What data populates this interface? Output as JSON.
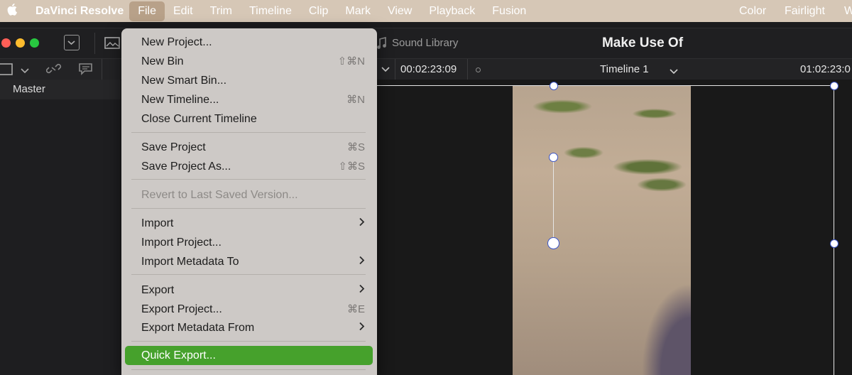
{
  "menubar": {
    "app_name": "DaVinci Resolve",
    "menus": [
      "File",
      "Edit",
      "Trim",
      "Timeline",
      "Clip",
      "Mark",
      "View",
      "Playback",
      "Fusion"
    ],
    "right_menus": [
      "Color",
      "Fairlight",
      "W"
    ],
    "active_menu": "File"
  },
  "window": {
    "project_title": "Make Use Of",
    "sound_library_label": "Sound Library",
    "traffic_lights": {
      "close": "#ff5f57",
      "minimize": "#febc2e",
      "zoom": "#28c840"
    }
  },
  "toolbar": {
    "timecode_left": "00:02:23:09",
    "timeline_name": "Timeline 1",
    "timecode_right": "01:02:23:0"
  },
  "media_pool": {
    "master_label": "Master"
  },
  "file_menu": {
    "items": [
      {
        "label": "New Project...",
        "shortcut": "",
        "submenu": false,
        "enabled": true
      },
      {
        "label": "New Bin",
        "shortcut": "⇧⌘N",
        "submenu": false,
        "enabled": true
      },
      {
        "label": "New Smart Bin...",
        "shortcut": "",
        "submenu": false,
        "enabled": true
      },
      {
        "label": "New Timeline...",
        "shortcut": "⌘N",
        "submenu": false,
        "enabled": true
      },
      {
        "label": "Close Current Timeline",
        "shortcut": "",
        "submenu": false,
        "enabled": true
      },
      {
        "label": "Save Project",
        "shortcut": "⌘S",
        "submenu": false,
        "enabled": true
      },
      {
        "label": "Save Project As...",
        "shortcut": "⇧⌘S",
        "submenu": false,
        "enabled": true
      },
      {
        "label": "Revert to Last Saved Version...",
        "shortcut": "",
        "submenu": false,
        "enabled": false
      },
      {
        "label": "Import",
        "shortcut": "",
        "submenu": true,
        "enabled": true
      },
      {
        "label": "Import Project...",
        "shortcut": "",
        "submenu": false,
        "enabled": true
      },
      {
        "label": "Import Metadata To",
        "shortcut": "",
        "submenu": true,
        "enabled": true
      },
      {
        "label": "Export",
        "shortcut": "",
        "submenu": true,
        "enabled": true
      },
      {
        "label": "Export Project...",
        "shortcut": "⌘E",
        "submenu": false,
        "enabled": true
      },
      {
        "label": "Export Metadata From",
        "shortcut": "",
        "submenu": true,
        "enabled": true
      },
      {
        "label": "Quick Export...",
        "shortcut": "",
        "submenu": false,
        "enabled": true,
        "highlighted": true
      }
    ],
    "highlight_color": "#46a12c"
  }
}
